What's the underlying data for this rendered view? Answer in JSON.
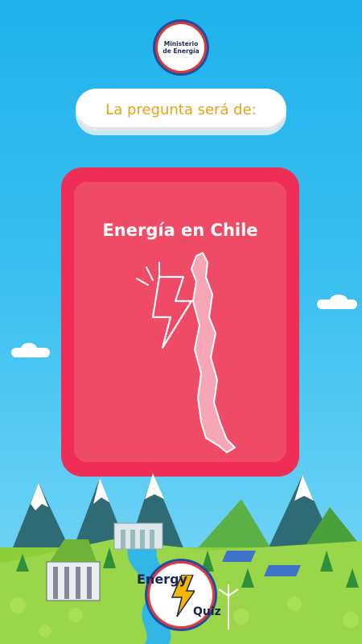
{
  "header": {
    "logo_text_line1": "Ministerio",
    "logo_text_line2": "de Energía"
  },
  "prompt": {
    "text": "La pregunta será de:"
  },
  "category_card": {
    "title": "Energía en Chile",
    "icon": "chile-map-lightning-icon",
    "card_color": "#ee2e56"
  },
  "game_logo": {
    "word1": "Energy",
    "word2": "Quiz",
    "icon": "lightning-bolt-icon",
    "bolt_color": "#f7b500"
  },
  "colors": {
    "sky": "#3cc0f0",
    "prompt_text": "#e8a214",
    "mountain": "#2f6b74",
    "grass": "#8ccf3a"
  }
}
